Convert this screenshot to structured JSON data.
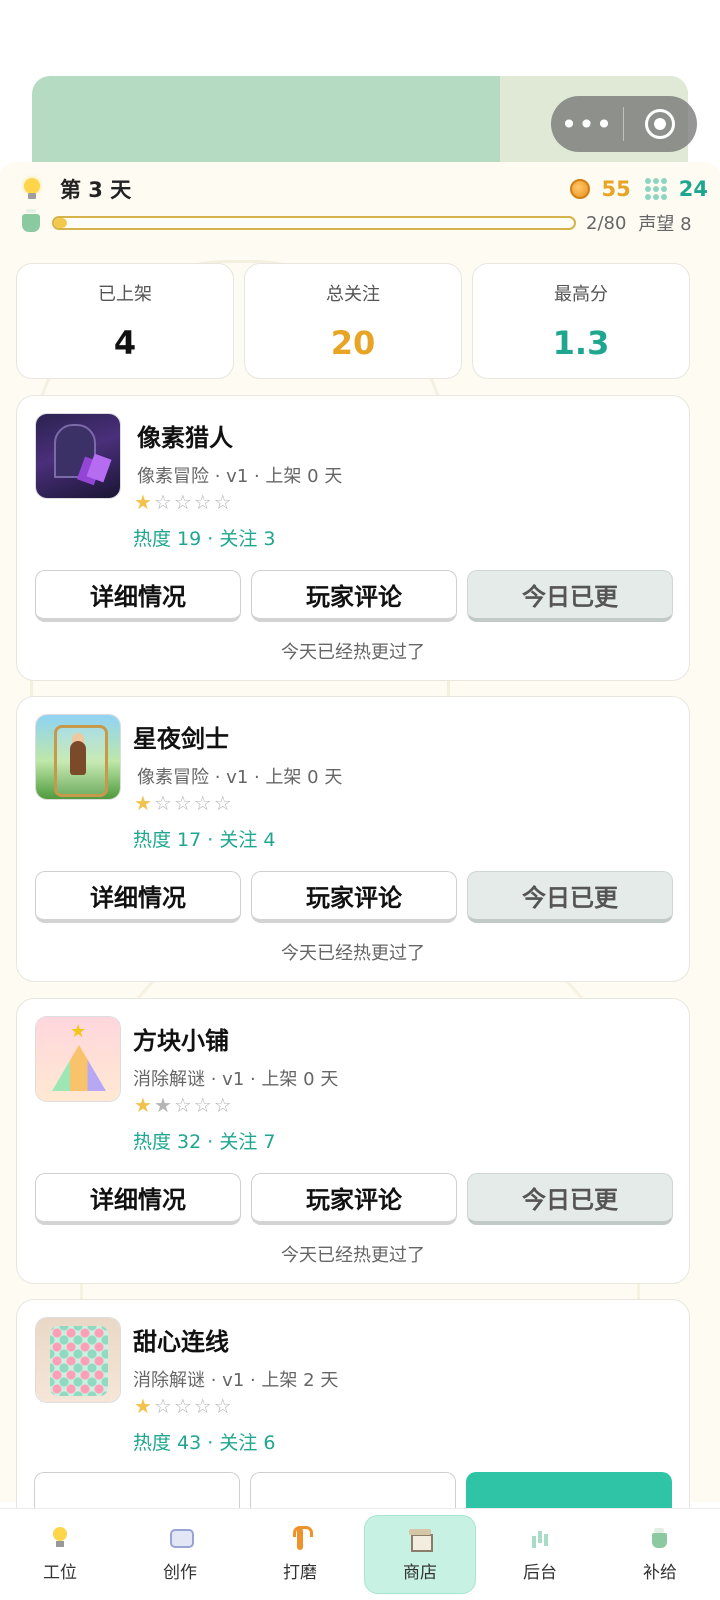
{
  "header": {
    "day_label": "第 3 天",
    "coins": "55",
    "gems": "24",
    "progress_fraction": 0.025,
    "progress_text": "2/80",
    "reputation_text": "声望 8"
  },
  "stats": [
    {
      "label": "已上架",
      "value": "4"
    },
    {
      "label": "总关注",
      "value": "20"
    },
    {
      "label": "最高分",
      "value": "1.3"
    }
  ],
  "games": [
    {
      "title": "像素猎人",
      "meta": "像素冒险 · v1 · 上架 0 天",
      "stars_on": "★",
      "stars_off": "☆☆☆☆",
      "heat": "热度 19 · 关注 3",
      "note": "今天已经热更过了"
    },
    {
      "title": "星夜剑士",
      "meta": "像素冒险 · v1 · 上架 0 天",
      "stars_on": "★",
      "stars_off": "☆☆☆☆",
      "heat": "热度 17 · 关注 4",
      "note": "今天已经热更过了"
    },
    {
      "title": "方块小铺",
      "meta": "消除解谜 · v1 · 上架 0 天",
      "stars_on": "★",
      "stars_off": "★☆☆☆",
      "heat": "热度 32 · 关注 7",
      "note": "今天已经热更过了"
    },
    {
      "title": "甜心连线",
      "meta": "消除解谜 · v1 · 上架 2 天",
      "stars_on": "★",
      "stars_off": "☆☆☆☆",
      "heat": "热度 43 · 关注 6"
    }
  ],
  "buttons": {
    "details": "详细情况",
    "reviews": "玩家评论",
    "updated": "今日已更"
  },
  "nav": [
    {
      "label": "工位",
      "icon": "bulb-icon"
    },
    {
      "label": "创作",
      "icon": "chat-icon"
    },
    {
      "label": "打磨",
      "icon": "wrench-icon"
    },
    {
      "label": "商店",
      "icon": "shop-icon",
      "active": true
    },
    {
      "label": "后台",
      "icon": "chart-icon"
    },
    {
      "label": "补给",
      "icon": "cup-icon"
    }
  ],
  "capsule": {
    "more": "•••"
  },
  "colors": {
    "accent": "#1fa68f",
    "gold": "#e8a424",
    "active_tab": "#c7f1e3"
  }
}
